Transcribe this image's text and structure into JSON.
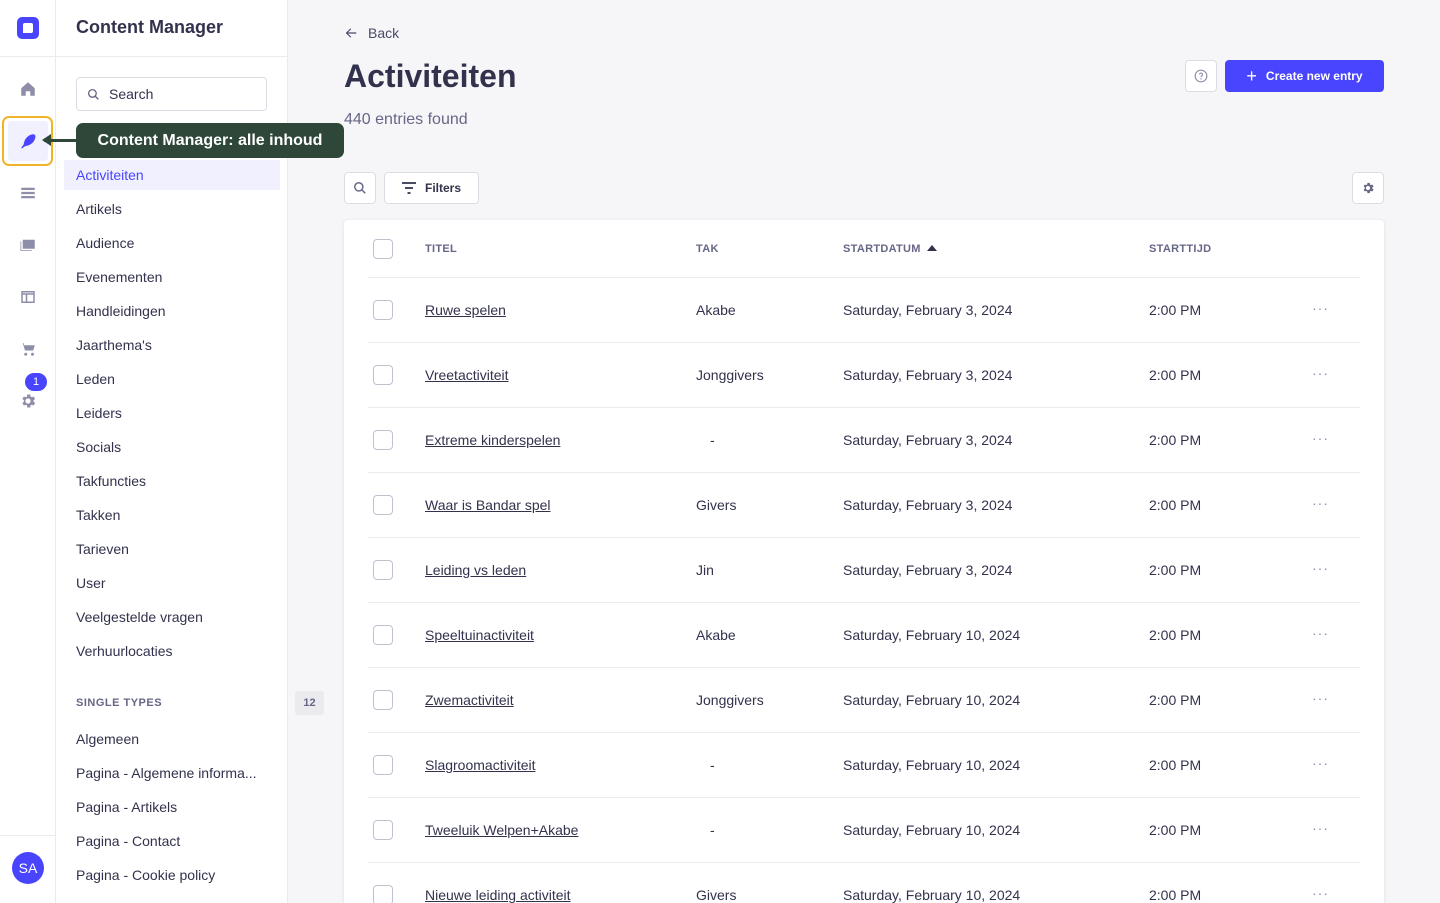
{
  "app": {
    "section_title": "Content Manager",
    "avatar_initials": "SA",
    "settings_badge": "1"
  },
  "rail": {
    "icons": [
      "home-icon",
      "feather-icon",
      "list-icon",
      "media-icon",
      "layout-icon",
      "cart-icon",
      "gear-icon"
    ],
    "active": "feather-icon"
  },
  "tooltip": {
    "text": "Content Manager: alle inhoud"
  },
  "subnav": {
    "search_placeholder": "Search",
    "collection_types": [
      "Activiteiten",
      "Artikels",
      "Audience",
      "Evenementen",
      "Handleidingen",
      "Jaarthema's",
      "Leden",
      "Leiders",
      "Socials",
      "Takfuncties",
      "Takken",
      "Tarieven",
      "User",
      "Veelgestelde vragen",
      "Verhuurlocaties"
    ],
    "active_item": "Activiteiten",
    "single_types_label": "SINGLE TYPES",
    "single_types_count": "12",
    "single_types": [
      "Algemeen",
      "Pagina - Algemene informa...",
      "Pagina - Artikels",
      "Pagina - Contact",
      "Pagina - Cookie policy"
    ]
  },
  "header": {
    "back_label": "Back",
    "title": "Activiteiten",
    "entries_found": "440 entries found",
    "create_label": "Create new entry",
    "filters_label": "Filters"
  },
  "table": {
    "columns": [
      "TITEL",
      "TAK",
      "STARTDATUM",
      "STARTTIJD"
    ],
    "sorted_column": "STARTDATUM",
    "rows": [
      {
        "titel": "Ruwe spelen",
        "tak": "Akabe",
        "startdatum": "Saturday, February 3, 2024",
        "starttijd": "2:00 PM"
      },
      {
        "titel": "Vreetactiviteit",
        "tak": "Jonggivers",
        "startdatum": "Saturday, February 3, 2024",
        "starttijd": "2:00 PM"
      },
      {
        "titel": "Extreme kinderspelen",
        "tak": "-",
        "startdatum": "Saturday, February 3, 2024",
        "starttijd": "2:00 PM"
      },
      {
        "titel": "Waar is Bandar spel",
        "tak": "Givers",
        "startdatum": "Saturday, February 3, 2024",
        "starttijd": "2:00 PM"
      },
      {
        "titel": "Leiding vs leden",
        "tak": "Jin",
        "startdatum": "Saturday, February 3, 2024",
        "starttijd": "2:00 PM"
      },
      {
        "titel": "Speeltuinactiviteit",
        "tak": "Akabe",
        "startdatum": "Saturday, February 10, 2024",
        "starttijd": "2:00 PM"
      },
      {
        "titel": "Zwemactiviteit",
        "tak": "Jonggivers",
        "startdatum": "Saturday, February 10, 2024",
        "starttijd": "2:00 PM"
      },
      {
        "titel": "Slagroomactiviteit",
        "tak": "-",
        "startdatum": "Saturday, February 10, 2024",
        "starttijd": "2:00 PM"
      },
      {
        "titel": "Tweeluik Welpen+Akabe",
        "tak": "-",
        "startdatum": "Saturday, February 10, 2024",
        "starttijd": "2:00 PM"
      },
      {
        "titel": "Nieuwe leiding activiteit",
        "tak": "Givers",
        "startdatum": "Saturday, February 10, 2024",
        "starttijd": "2:00 PM"
      }
    ]
  },
  "colors": {
    "primary": "#4945ff",
    "tooltip_bg": "#2e4739",
    "highlight": "#f0b429"
  }
}
